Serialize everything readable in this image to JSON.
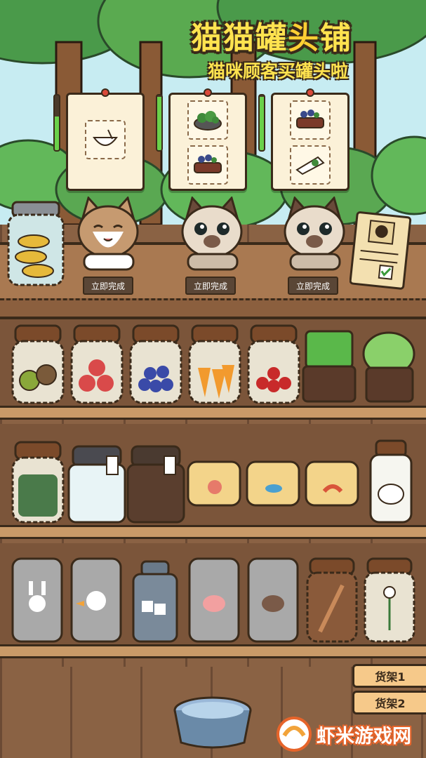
{
  "header": {
    "title_main": "猫猫罐",
    "title_accent": "头",
    "title_end": "铺",
    "subtitle": "猫咪顾客买罐头啦"
  },
  "customers": [
    {
      "order_items": [
        "bowl-icon"
      ],
      "patience": 0.62,
      "cat": "tabby",
      "done_label": "立即完成"
    },
    {
      "order_items": [
        "salad-icon",
        "grilled-meat-icon"
      ],
      "patience": 0.98,
      "cat": "siamese",
      "done_label": "立即完成"
    },
    {
      "order_items": [
        "grilled-meat-icon",
        "wrap-icon"
      ],
      "patience": 0.98,
      "cat": "siamese",
      "done_label": "立即完成"
    }
  ],
  "shelves": [
    {
      "items": [
        "kiwi-jar",
        "strawberry-jar",
        "blueberry-jar",
        "carrot-jar",
        "cherry-jar",
        "wheatgrass-pot",
        "lettuce-pot"
      ]
    },
    {
      "items": [
        "herb-jar",
        "milk-jug",
        "dark-jug",
        "shrimp-can",
        "fish-can",
        "prawn-can",
        "sheep-milk-bottle"
      ]
    },
    {
      "items": [
        "rabbit-can",
        "duck-can",
        "tofu-can",
        "pig-can",
        "cow-can",
        "stick-jar",
        "flower-jar"
      ]
    }
  ],
  "tabs": {
    "shelf1": "货架1",
    "shelf2": "货架2"
  },
  "watermark": {
    "text": "虾米游戏网"
  },
  "colors": {
    "title_fill": "#ffe34f",
    "outline": "#3a2a1a",
    "patience_green": "#6ad14a",
    "wood": "#a97951"
  }
}
